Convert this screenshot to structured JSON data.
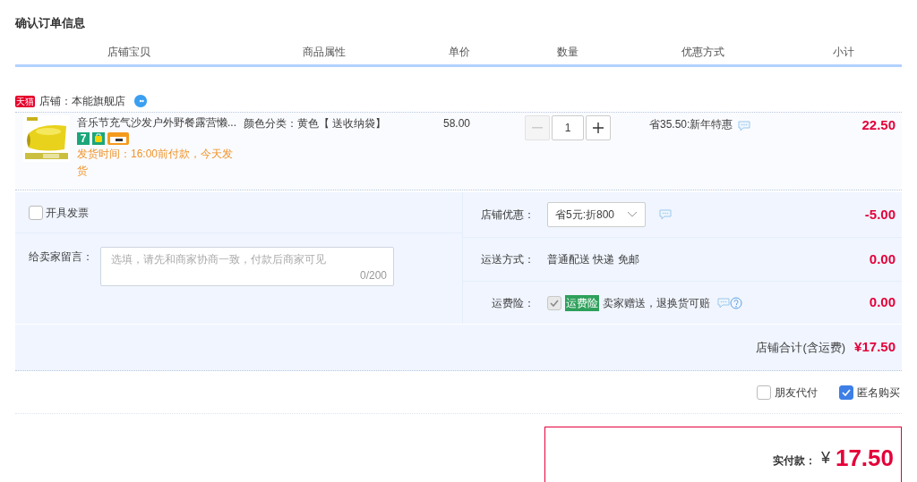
{
  "title": "确认订单信息",
  "columns": [
    "店铺宝贝",
    "商品属性",
    "单价",
    "数量",
    "优惠方式",
    "小计"
  ],
  "shop": {
    "badge": "天猫",
    "name": "店铺：本能旗舰店"
  },
  "item": {
    "title": "音乐节充气沙发户外野餐露营懒...",
    "attributes": "颜色分类：黄色【 送收纳袋】",
    "badges": [
      {
        "kind": "label",
        "label": "7"
      },
      {
        "kind": "bag"
      },
      {
        "kind": "card"
      }
    ],
    "delivery": "发货时间：16:00前付款，今天发货",
    "price": "58.00",
    "quantity": "1",
    "minus_disabled": true,
    "discount": "省35.50:新年特惠",
    "subtotal": "22.50"
  },
  "invoice": {
    "label": "开具发票",
    "checked": false
  },
  "message": {
    "label": "给卖家留言：",
    "placeholder": "选填，请先和商家协商一致，付款后商家可见",
    "counter": "0/200"
  },
  "shop_discount": {
    "label": "店铺优惠：",
    "value": "省5元:折800",
    "amount": "-5.00"
  },
  "shipping": {
    "label": "运送方式：",
    "value": "普通配送 快递 免邮",
    "amount": "0.00"
  },
  "insurance": {
    "label": "运费险：",
    "checked": true,
    "disabled": true,
    "tag": "运费险",
    "text": "卖家赠送，退换货可赔",
    "amount": "0.00"
  },
  "shop_total": {
    "label": "店铺合计(含运费)",
    "amount": "¥17.50"
  },
  "options": [
    {
      "label": "朋友代付",
      "checked": false
    },
    {
      "label": "匿名购买",
      "checked": true
    }
  ],
  "payment": {
    "label": "实付款：",
    "currency": "¥",
    "amount": "17.50"
  }
}
